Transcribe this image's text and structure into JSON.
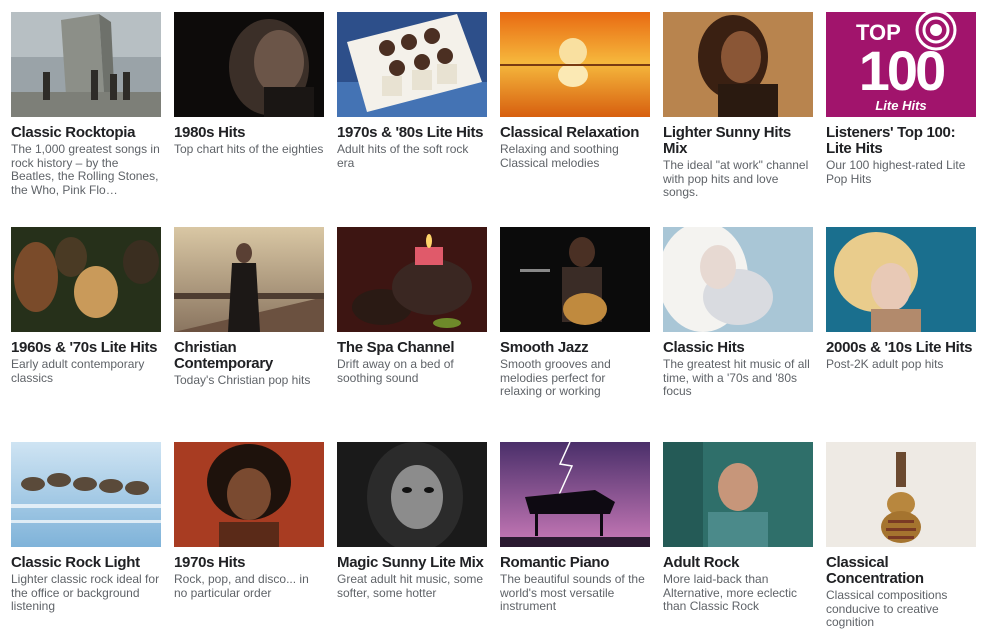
{
  "stations": [
    {
      "title": "Classic Rocktopia",
      "description": "The 1,000 greatest songs in rock history – by the Beatles, the Rolling Stones, the Who, Pink Flo…",
      "art": "band-monolith"
    },
    {
      "title": "1980s Hits",
      "description": "Top chart hits of the eighties",
      "art": "dark-portrait"
    },
    {
      "title": "1970s & '80s Lite Hits",
      "description": "Adult hits of the soft rock era",
      "art": "group-photo"
    },
    {
      "title": "Classical Relaxation",
      "description": "Relaxing and soothing Classical melodies",
      "art": "sunset-reflection"
    },
    {
      "title": "Lighter Sunny Hits Mix",
      "description": "The ideal \"at work\" channel with pop hits and love songs.",
      "art": "singer-portrait"
    },
    {
      "title": "Listeners' Top 100: Lite Hits",
      "description": "Our 100 highest-rated Lite Pop Hits",
      "art": "top100-badge",
      "badge": {
        "top": "TOP",
        "number": "100",
        "subtitle": "Lite Hits"
      }
    },
    {
      "title": "1960s & '70s Lite Hits",
      "description": "Early adult contemporary classics",
      "art": "vintage-group"
    },
    {
      "title": "Christian Contemporary",
      "description": "Today's Christian pop hits",
      "art": "man-on-pier"
    },
    {
      "title": "The Spa Channel",
      "description": "Drift away on a bed of soothing sound",
      "art": "spa-candle"
    },
    {
      "title": "Smooth Jazz",
      "description": "Smooth grooves and melodies perfect for relaxing or working",
      "art": "guitarist"
    },
    {
      "title": "Classic Hits",
      "description": "The greatest hit music of all time, with a '70s and '80s focus",
      "art": "pop-portrait"
    },
    {
      "title": "2000s & '10s Lite Hits",
      "description": "Post-2K adult pop hits",
      "art": "blonde-singer"
    },
    {
      "title": "Classic Rock Light",
      "description": "Lighter classic rock ideal for the office or background listening",
      "art": "horses-surf"
    },
    {
      "title": "1970s Hits",
      "description": "Rock, pop, and disco... in no particular order",
      "art": "soul-singer"
    },
    {
      "title": "Magic Sunny Lite Mix",
      "description": "Great adult hit music, some softer, some hotter",
      "art": "bw-portrait"
    },
    {
      "title": "Romantic Piano",
      "description": "The beautiful sounds of the world's most versatile instrument",
      "art": "piano-storm"
    },
    {
      "title": "Adult Rock",
      "description": "More laid-back than Alternative, more eclectic than Classic Rock",
      "art": "man-teal"
    },
    {
      "title": "Classical Concentration",
      "description": "Classical compositions conducive to creative cognition",
      "art": "book-guitar"
    }
  ],
  "colors": {
    "title": "#202124",
    "description": "#5f6368",
    "top100_bg": "#a1146c"
  }
}
